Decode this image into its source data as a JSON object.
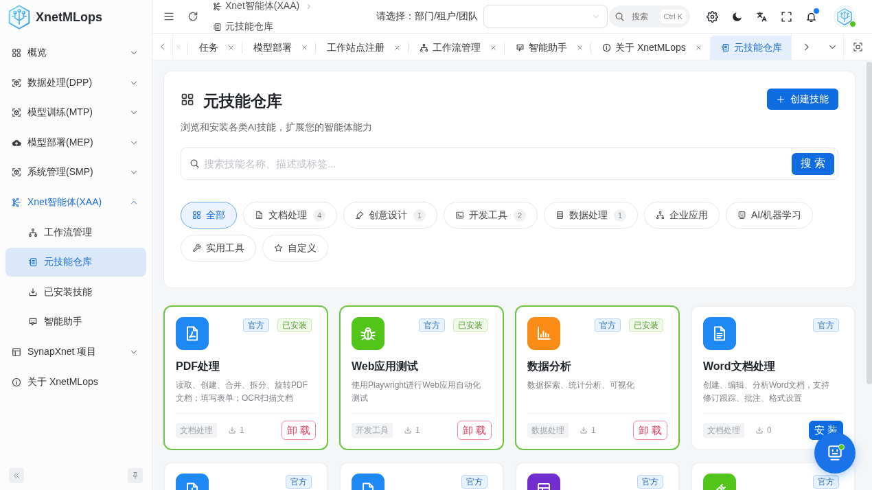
{
  "app": {
    "name": "XnetMLops"
  },
  "sidebar": {
    "items": [
      {
        "label": "概览",
        "expanded": false,
        "selected": false
      },
      {
        "label": "数据处理(DPP)",
        "expanded": false,
        "selected": false
      },
      {
        "label": "模型训练(MTP)",
        "expanded": false,
        "selected": false
      },
      {
        "label": "模型部署(MEP)",
        "expanded": false,
        "selected": false
      },
      {
        "label": "系统管理(SMP)",
        "expanded": false,
        "selected": false
      },
      {
        "label": "Xnet智能体(XAA)",
        "expanded": true,
        "selected": false,
        "children": [
          {
            "label": "工作流管理",
            "selected": false
          },
          {
            "label": "元技能仓库",
            "selected": true
          },
          {
            "label": "已安装技能",
            "selected": false
          },
          {
            "label": "智能助手",
            "selected": false
          }
        ]
      },
      {
        "label": "SynapXnet 项目",
        "expanded": false,
        "selected": false
      },
      {
        "label": "关于 XnetMLops",
        "selected": false
      }
    ]
  },
  "toolbar": {
    "breadcrumb": [
      {
        "label": "Xnet智能体(XAA)"
      },
      {
        "label": "元技能仓库"
      }
    ],
    "org_select": {
      "label": "请选择：部门/租户/团队"
    },
    "search": {
      "label": "搜索",
      "shortcut": "Ctrl K"
    },
    "notifications": {
      "unread": true
    },
    "user": {
      "online": true
    }
  },
  "tabs": [
    {
      "kind": "clipped",
      "selected": false
    },
    {
      "kind": "tab",
      "label": "任务",
      "selected": false
    },
    {
      "kind": "tab",
      "label": "模型部署",
      "selected": false
    },
    {
      "kind": "tab",
      "label": "工作站点注册",
      "selected": false
    },
    {
      "kind": "tab",
      "label": "工作流管理",
      "selected": false
    },
    {
      "kind": "tab",
      "label": "智能助手",
      "selected": false
    },
    {
      "kind": "tab",
      "label": "关于 XnetMLops",
      "selected": false
    },
    {
      "kind": "tab",
      "label": "元技能仓库",
      "selected": true
    }
  ],
  "page": {
    "title": "元技能仓库",
    "subtitle": "浏览和安装各类AI技能，扩展您的智能体能力",
    "create_button": "创建技能",
    "search": {
      "placeholder": "搜索技能名称、描述或标签...",
      "button": "搜 索"
    },
    "categories": [
      {
        "label": "全部",
        "selected": true
      },
      {
        "label": "文档处理",
        "count": "4",
        "selected": false
      },
      {
        "label": "创意设计",
        "count": "1",
        "selected": false
      },
      {
        "label": "开发工具",
        "count": "2",
        "selected": false
      },
      {
        "label": "数据处理",
        "count": "1",
        "selected": false
      },
      {
        "label": "企业应用",
        "selected": false
      },
      {
        "label": "AI/机器学习",
        "selected": false
      },
      {
        "label": "实用工具",
        "selected": false
      },
      {
        "label": "自定义",
        "selected": false
      }
    ]
  },
  "cards": [
    {
      "title": "PDF处理",
      "description": "读取、创建、合并、拆分、旋转PDF文档；填写表单；OCR扫描文档",
      "color": "#1e88f5",
      "installed": true,
      "badges": [
        {
          "kind": "official",
          "label": "官方"
        },
        {
          "kind": "installed",
          "label": "已安装"
        }
      ],
      "category": "文档处理",
      "downloads": "1",
      "action": {
        "kind": "uninstall",
        "label": "卸 载"
      }
    },
    {
      "title": "Web应用测试",
      "description": "使用Playwright进行Web应用自动化测试",
      "color": "#52c41a",
      "installed": true,
      "badges": [
        {
          "kind": "official",
          "label": "官方"
        },
        {
          "kind": "installed",
          "label": "已安装"
        }
      ],
      "category": "开发工具",
      "downloads": "1",
      "action": {
        "kind": "uninstall",
        "label": "卸 载"
      }
    },
    {
      "title": "数据分析",
      "description": "数据探索、统计分析、可视化",
      "color": "#fa8c16",
      "installed": true,
      "badges": [
        {
          "kind": "official",
          "label": "官方"
        },
        {
          "kind": "installed",
          "label": "已安装"
        }
      ],
      "category": "数据处理",
      "downloads": "1",
      "action": {
        "kind": "uninstall",
        "label": "卸 载"
      }
    },
    {
      "title": "Word文档处理",
      "description": "创建、编辑、分析Word文档，支持修订跟踪、批注、格式设置",
      "color": "#1e88f5",
      "installed": false,
      "badges": [
        {
          "kind": "official",
          "label": "官方"
        }
      ],
      "category": "文档处理",
      "downloads": "0",
      "action": {
        "kind": "install",
        "label": "安 装"
      }
    },
    {
      "color": "#1e88f5",
      "installed": false,
      "badges": [
        {
          "kind": "official",
          "label": "官方"
        }
      ]
    },
    {
      "color": "#1e88f5",
      "installed": false,
      "badges": [
        {
          "kind": "official",
          "label": "官方"
        }
      ]
    },
    {
      "color": "#722ed1",
      "installed": false,
      "badges": [
        {
          "kind": "official",
          "label": "官方"
        }
      ]
    },
    {
      "color": "#52c41a",
      "installed": false,
      "badges": [
        {
          "kind": "official",
          "label": "官方"
        }
      ]
    }
  ],
  "assistant_button": {
    "online": true
  }
}
